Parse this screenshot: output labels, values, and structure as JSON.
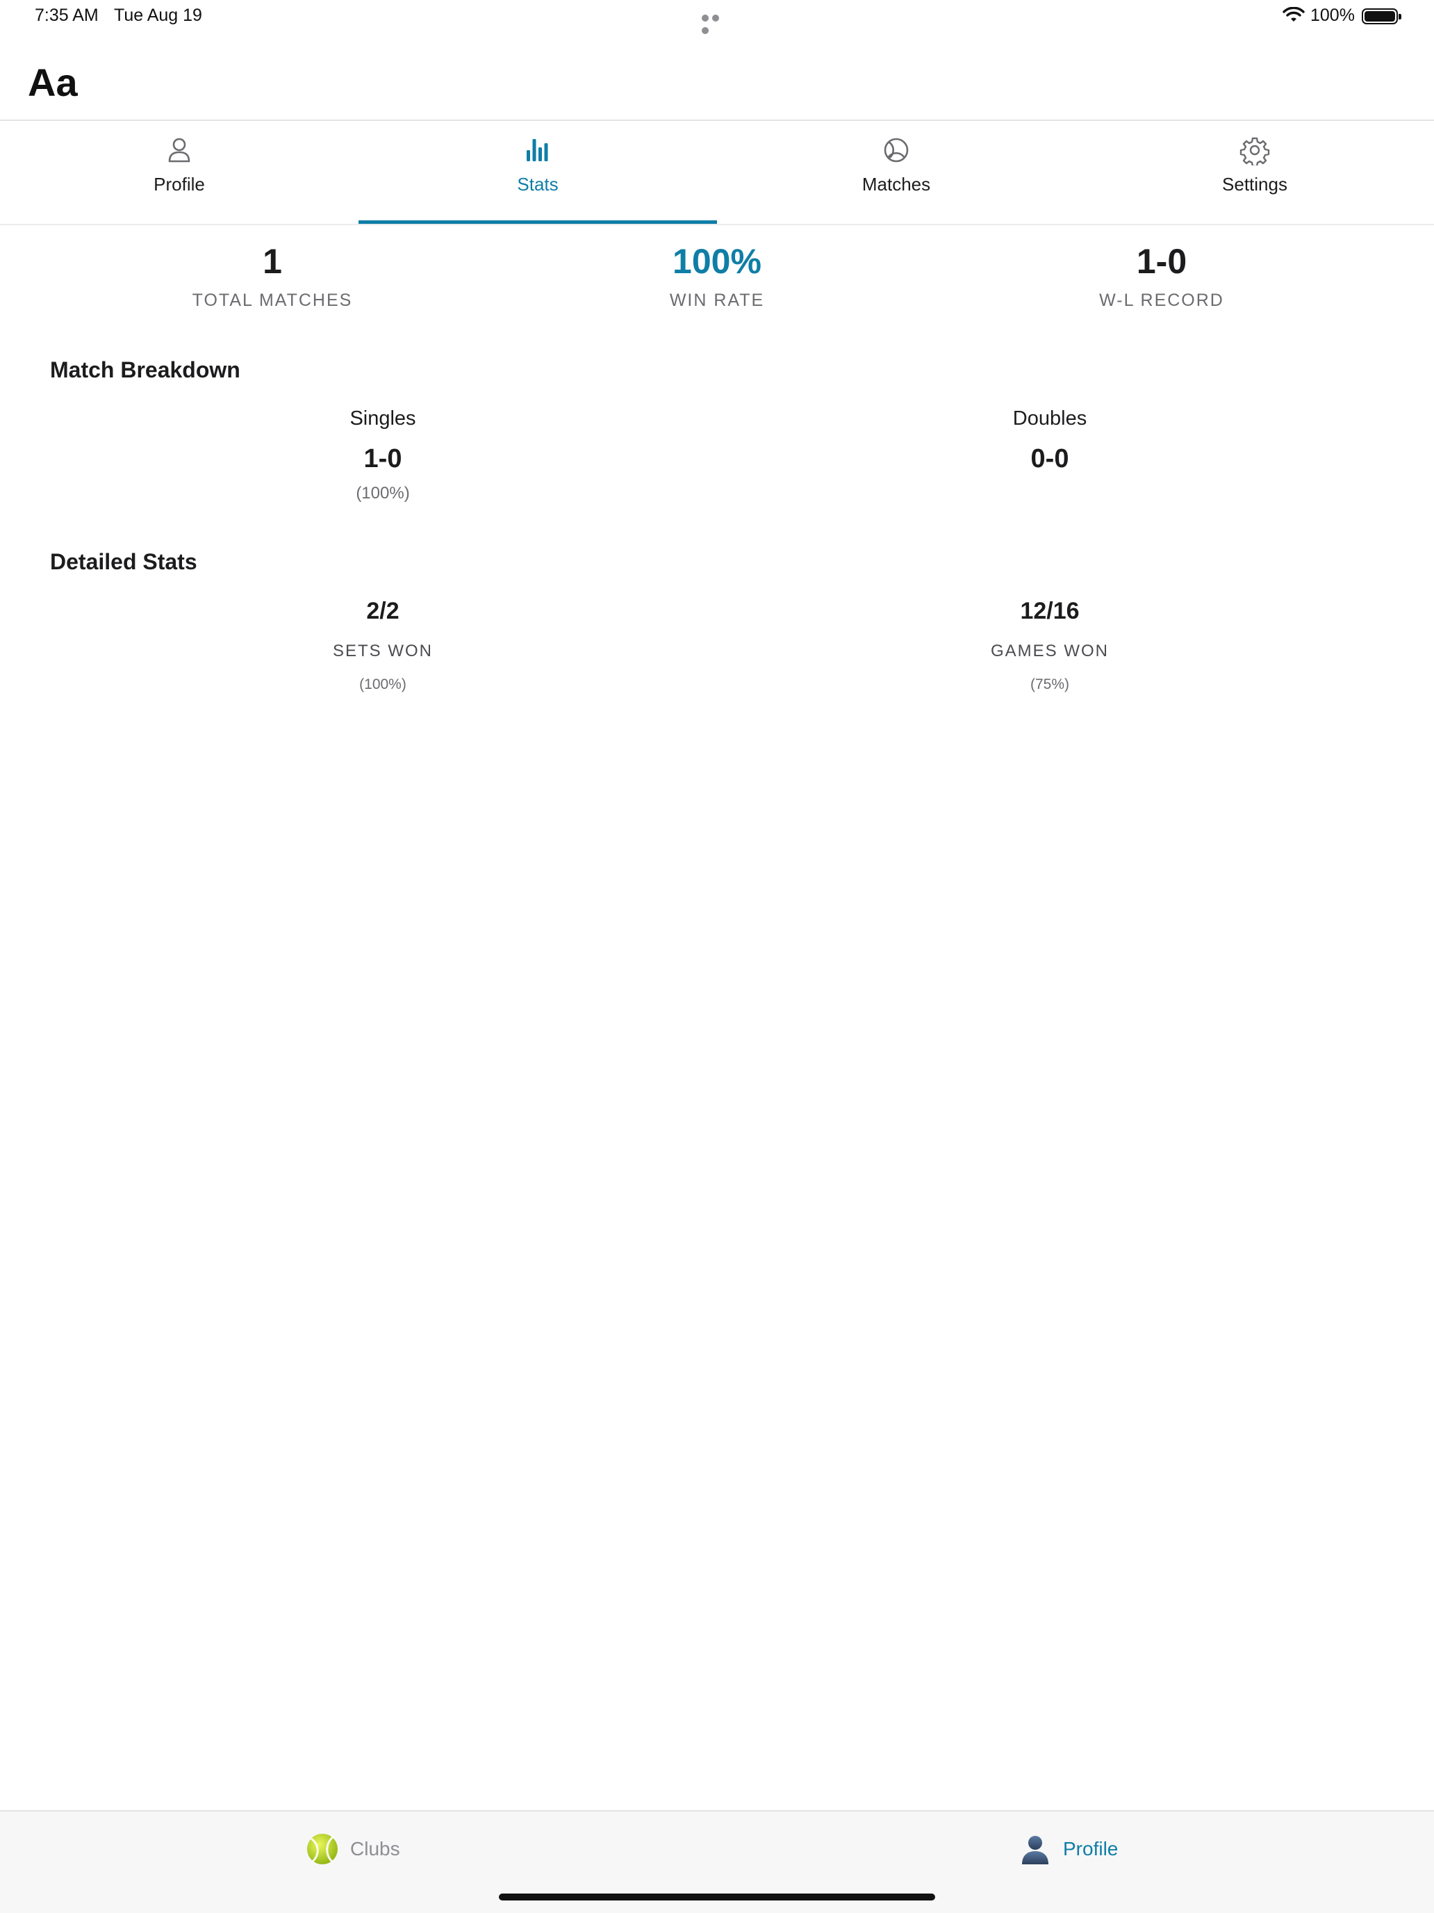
{
  "status_bar": {
    "time": "7:35 AM",
    "date": "Tue Aug 19",
    "battery_percent": "100%",
    "battery_level": 1.0
  },
  "header": {
    "title": "Aa"
  },
  "tabs": [
    {
      "label": "Profile",
      "icon": "person-icon",
      "active": false
    },
    {
      "label": "Stats",
      "icon": "bar-chart-icon",
      "active": true
    },
    {
      "label": "Matches",
      "icon": "tennis-ball-icon",
      "active": false
    },
    {
      "label": "Settings",
      "icon": "gear-icon",
      "active": false
    }
  ],
  "summary": {
    "total_matches": {
      "value": "1",
      "label": "TOTAL MATCHES"
    },
    "win_rate": {
      "value": "100%",
      "label": "WIN RATE"
    },
    "record": {
      "value": "1-0",
      "label": "W-L RECORD"
    }
  },
  "match_breakdown": {
    "title": "Match Breakdown",
    "singles": {
      "label": "Singles",
      "record": "1-0",
      "percent": "(100%)"
    },
    "doubles": {
      "label": "Doubles",
      "record": "0-0"
    }
  },
  "detailed_stats": {
    "title": "Detailed Stats",
    "sets": {
      "value": "2/2",
      "label": "SETS WON",
      "percent": "(100%)"
    },
    "games": {
      "value": "12/16",
      "label": "GAMES WON",
      "percent": "(75%)"
    }
  },
  "bottom_nav": {
    "clubs": {
      "label": "Clubs",
      "icon": "tennis-ball-icon"
    },
    "profile": {
      "label": "Profile",
      "icon": "user-silhouette-icon",
      "active": true
    }
  },
  "colors": {
    "accent": "#0f7ea6",
    "text": "#1c1c1e",
    "muted": "#6b6b70",
    "divider": "#e3e3e6"
  }
}
